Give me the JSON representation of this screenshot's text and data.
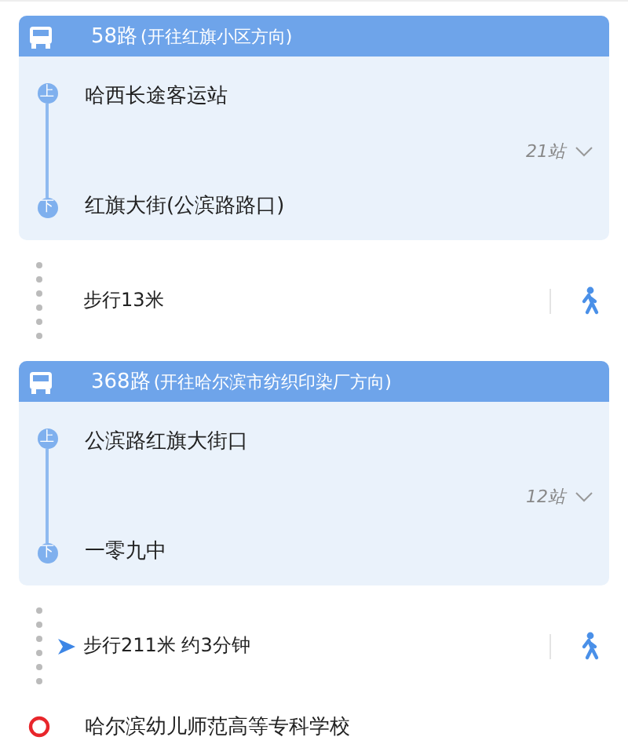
{
  "segments": [
    {
      "kind": "bus",
      "line": "58路",
      "direction": "(开往红旗小区方向)",
      "board_mark": "上",
      "board_stop": "哈西长途客运站",
      "stop_count": "21站",
      "alight_mark": "下",
      "alight_stop": "红旗大街(公滨路路口)"
    },
    {
      "kind": "walk",
      "text": "步行13米",
      "arrow": false
    },
    {
      "kind": "bus",
      "line": "368路",
      "direction": "(开往哈尔滨市纺织印染厂方向)",
      "board_mark": "上",
      "board_stop": "公滨路红旗大街口",
      "stop_count": "12站",
      "alight_mark": "下",
      "alight_stop": "一零九中"
    },
    {
      "kind": "walk",
      "text": "步行211米 约3分钟",
      "arrow": true
    },
    {
      "kind": "destination",
      "text": "哈尔滨幼儿师范高等专科学校"
    }
  ]
}
